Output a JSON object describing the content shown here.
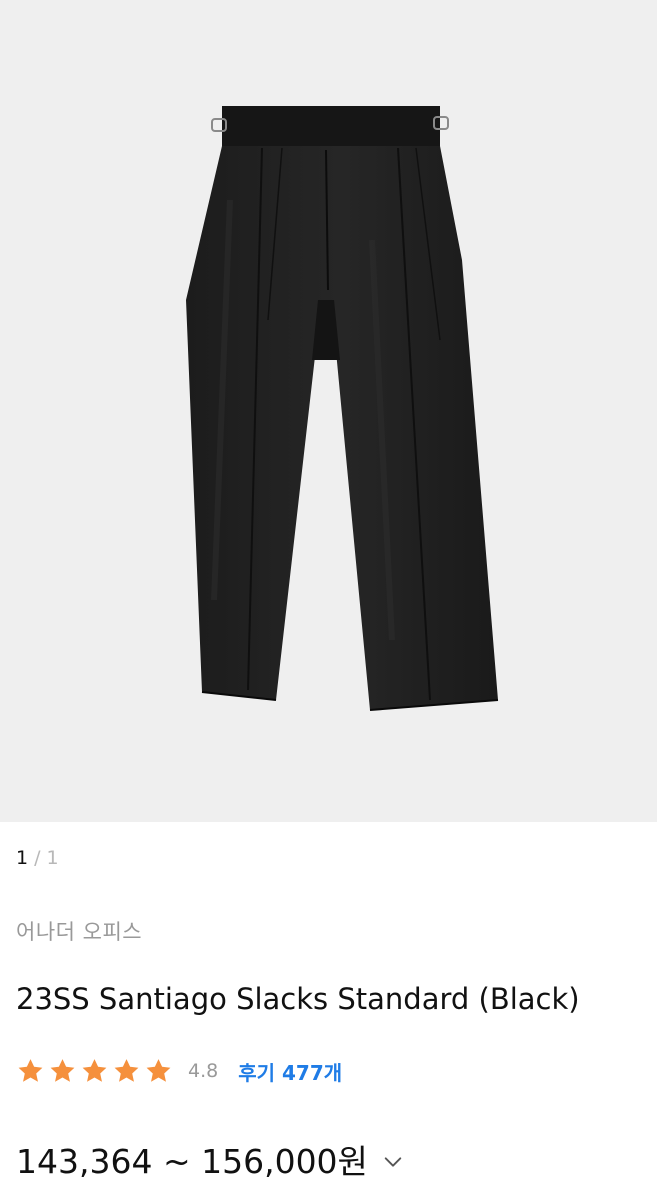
{
  "gallery": {
    "current": "1",
    "separator": "/",
    "total": "1",
    "image_icon": "black-pleated-trousers-photo"
  },
  "product": {
    "brand": "어나더 오피스",
    "title": "23SS Santiago Slacks Standard (Black)",
    "rating": {
      "stars": 5,
      "value": "4.8",
      "reviews_label": "후기 477개"
    },
    "price": "143,364 ~ 156,000원"
  },
  "colors": {
    "star": "#f5903c",
    "review_link": "#1f7ce6",
    "image_bg": "#efefef"
  }
}
